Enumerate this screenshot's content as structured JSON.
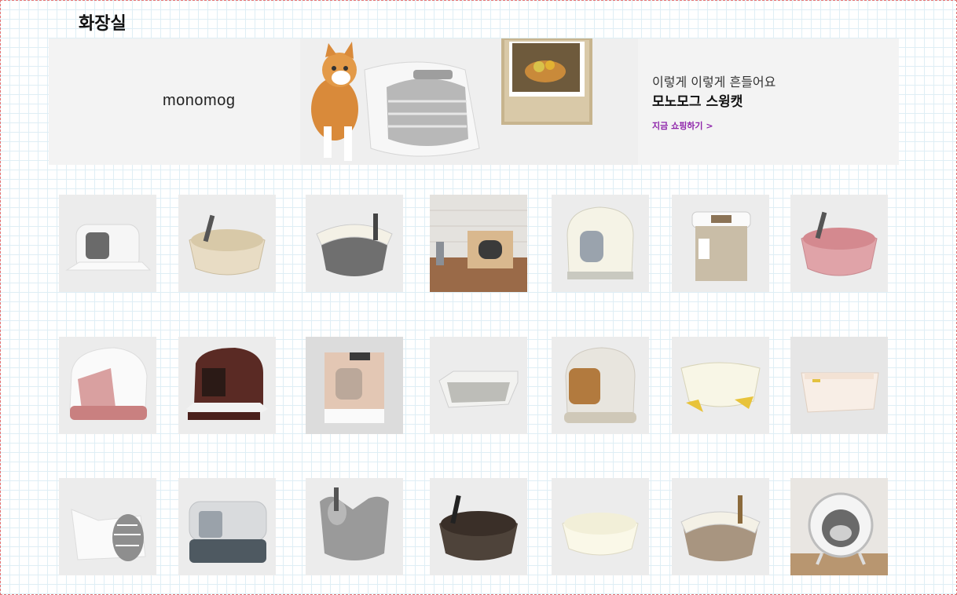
{
  "page": {
    "title": "화장실"
  },
  "banner": {
    "brand": "monomog",
    "line1": "이렇게 이렇게 흔들어요",
    "line2": "모노모그 스윙캣",
    "cta": "지금 쇼핑하기 >"
  },
  "products": [
    {
      "icon": "covered-litter-box-white"
    },
    {
      "icon": "open-litter-tray-beige"
    },
    {
      "icon": "open-litter-tray-grey"
    },
    {
      "icon": "wooden-litter-cabinet"
    },
    {
      "icon": "dome-litter-box-cream"
    },
    {
      "icon": "top-entry-litter-box-beige"
    },
    {
      "icon": "open-litter-tray-pink"
    },
    {
      "icon": "hooded-litter-box-pink"
    },
    {
      "icon": "hooded-litter-box-brown"
    },
    {
      "icon": "top-entry-litter-box-tan"
    },
    {
      "icon": "low-litter-tray-grey"
    },
    {
      "icon": "dome-litter-box-amber-door"
    },
    {
      "icon": "square-litter-tray-yellow"
    },
    {
      "icon": "square-litter-tray-ivory"
    },
    {
      "icon": "high-back-litter-tray-white"
    },
    {
      "icon": "hooded-litter-box-grey"
    },
    {
      "icon": "swing-litter-tray-grey"
    },
    {
      "icon": "oval-litter-tray-brown"
    },
    {
      "icon": "oval-litter-tray-ivory"
    },
    {
      "icon": "open-litter-tray-taupe"
    },
    {
      "icon": "automatic-litter-box-white"
    }
  ]
}
